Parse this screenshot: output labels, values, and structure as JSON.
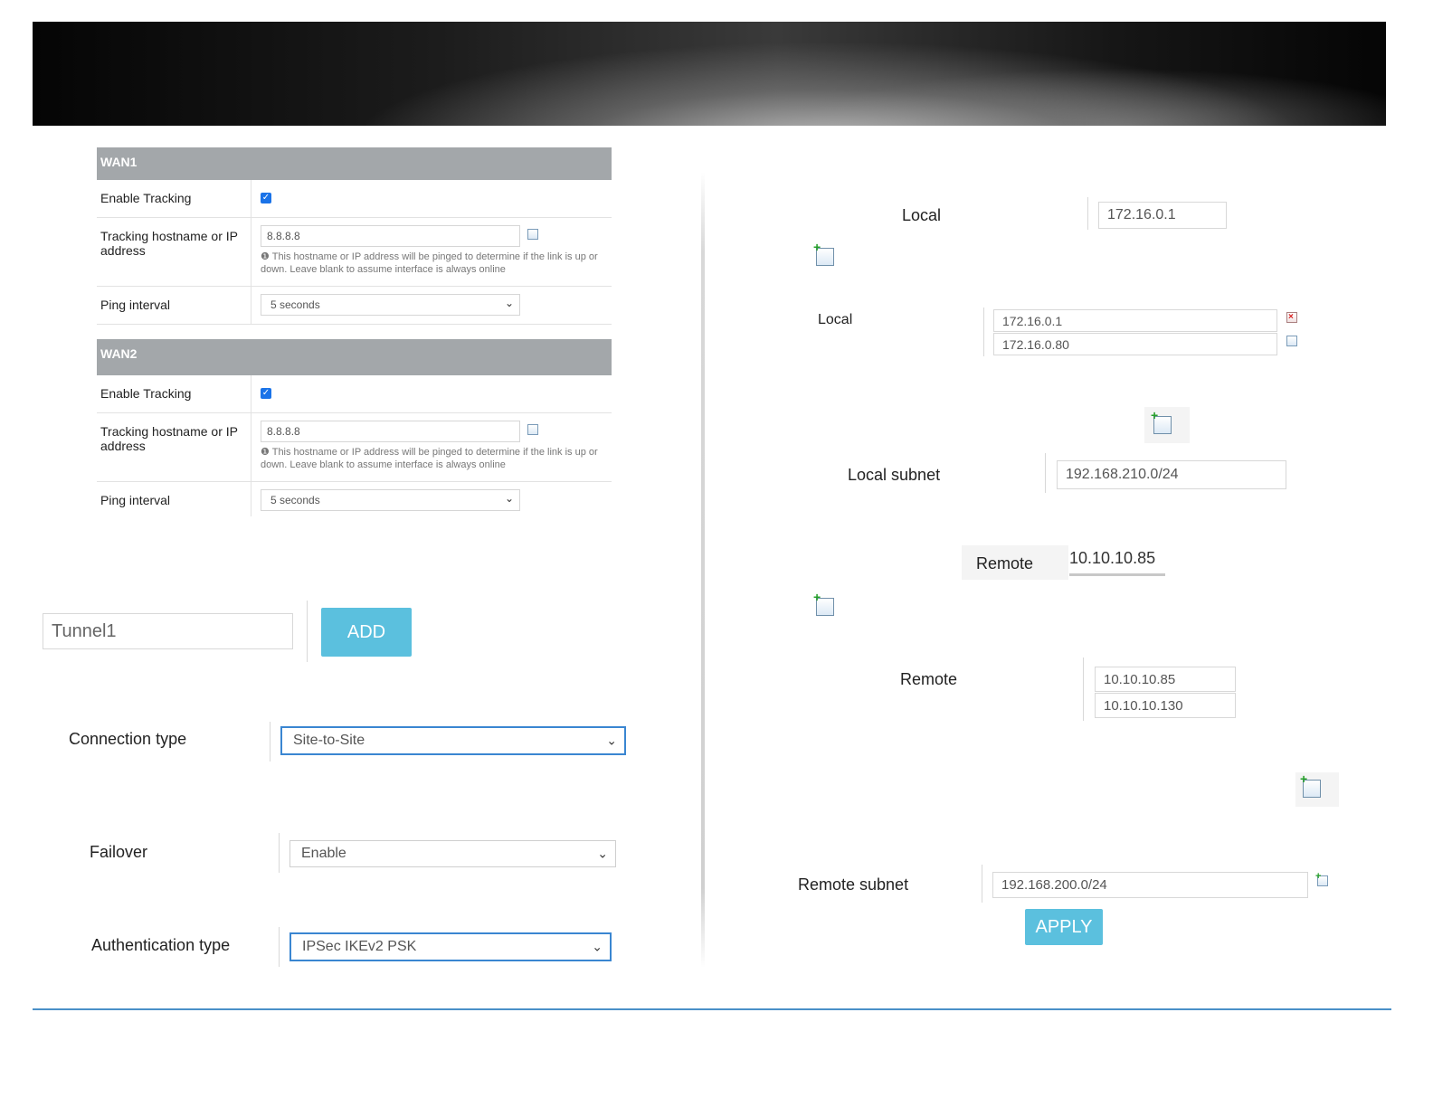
{
  "wan1": {
    "header": "WAN1",
    "enable_tracking_label": "Enable Tracking",
    "enable_tracking_checked": true,
    "tracking_label": "Tracking hostname or IP address",
    "tracking_value": "8.8.8.8",
    "tracking_help": "This hostname or IP address will be pinged to determine if the link is up or down. Leave blank to assume interface is always online",
    "ping_label": "Ping interval",
    "ping_value": "5 seconds"
  },
  "wan2": {
    "header": "WAN2",
    "enable_tracking_label": "Enable Tracking",
    "enable_tracking_checked": true,
    "tracking_label": "Tracking hostname or IP address",
    "tracking_value": "8.8.8.8",
    "tracking_help": "This hostname or IP address will be pinged to determine if the link is up or down. Leave blank to assume interface is always online",
    "ping_label": "Ping interval",
    "ping_value": "5 seconds"
  },
  "tunnel": {
    "name_value": "Tunnel1",
    "add_label": "ADD"
  },
  "connection": {
    "label": "Connection type",
    "value": "Site-to-Site"
  },
  "failover": {
    "label": "Failover",
    "value": "Enable"
  },
  "auth": {
    "label": "Authentication type",
    "value": "IPSec IKEv2 PSK"
  },
  "local_single": {
    "label": "Local",
    "value": "172.16.0.1"
  },
  "local_multi": {
    "label": "Local",
    "values": [
      "172.16.0.1",
      "172.16.0.80"
    ]
  },
  "local_subnet": {
    "label": "Local subnet",
    "value": "192.168.210.0/24"
  },
  "remote_single": {
    "label": "Remote",
    "value": "10.10.10.85"
  },
  "remote_multi": {
    "label": "Remote",
    "values": [
      "10.10.10.85",
      "10.10.10.130"
    ]
  },
  "remote_subnet": {
    "label": "Remote subnet",
    "value": "192.168.200.0/24"
  },
  "apply_label": "APPLY",
  "icons": {
    "add": "add-page-icon",
    "delete": "delete-page-icon",
    "help": "info-icon",
    "dropdown": "chevron-down-icon"
  }
}
